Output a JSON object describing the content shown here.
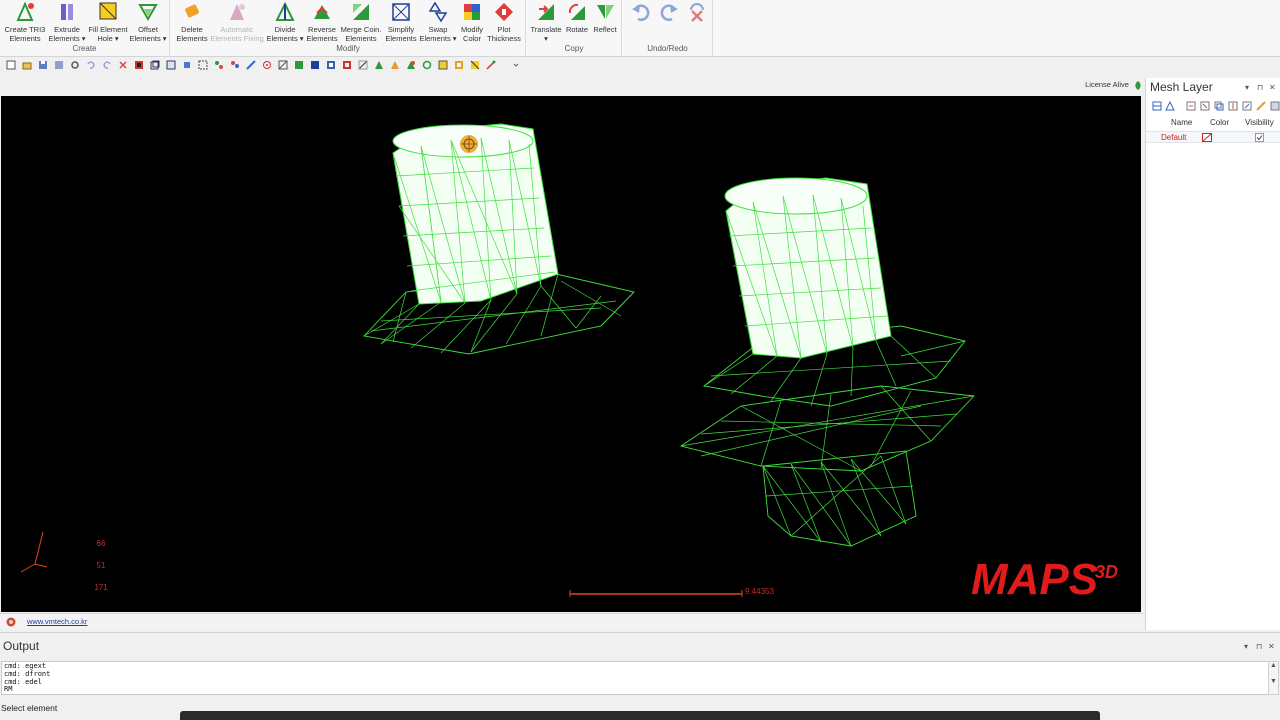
{
  "ribbon": {
    "groups": [
      {
        "label": "Create",
        "buttons": [
          {
            "line1": "Create TRI3",
            "line2": "Elements"
          },
          {
            "line1": "Extrude",
            "line2": "Elements ▾"
          },
          {
            "line1": "Fill Element",
            "line2": "Hole ▾"
          },
          {
            "line1": "Offset",
            "line2": "Elements ▾"
          }
        ]
      },
      {
        "label": "Modify",
        "buttons": [
          {
            "line1": "Delete",
            "line2": "Elements"
          },
          {
            "line1": "Automatic",
            "line2": "Elements Fixing",
            "disabled": true
          },
          {
            "line1": "Divide",
            "line2": "Elements ▾"
          },
          {
            "line1": "Reverse",
            "line2": "Elements"
          },
          {
            "line1": "Merge Coin.",
            "line2": "Elements"
          },
          {
            "line1": "Simplify",
            "line2": "Elements"
          },
          {
            "line1": "Swap",
            "line2": "Elements ▾"
          },
          {
            "line1": "Modify",
            "line2": "Color"
          },
          {
            "line1": "Plot",
            "line2": "Thickness"
          }
        ]
      },
      {
        "label": "Copy",
        "buttons": [
          {
            "line1": "Translate",
            "line2": "▾"
          },
          {
            "line1": "Rotate",
            "line2": ""
          },
          {
            "line1": "Reflect",
            "line2": ""
          }
        ]
      },
      {
        "label": "Undo/Redo",
        "buttons": []
      }
    ]
  },
  "license": {
    "text": "License Alive"
  },
  "viewport": {
    "background": "#000000",
    "mesh_color": "#3ee03e",
    "axis_numbers": [
      "66",
      "51",
      "171"
    ],
    "scale_value": "9.44353",
    "brand": {
      "name": "MAPS",
      "superscript": "3D",
      "color": "#e01b1b"
    }
  },
  "mesh_layer": {
    "title": "Mesh Layer",
    "columns": [
      "Name",
      "Color",
      "Visibility"
    ],
    "rows": [
      {
        "name": "Default",
        "visible": true
      }
    ]
  },
  "status_strip": {
    "url": "www.vmtech.co.kr"
  },
  "output": {
    "title": "Output",
    "lines": [
      "cmd: egext",
      "cmd: dfront",
      "cmd: edel",
      "RM"
    ]
  },
  "status": {
    "message": "Select element"
  }
}
